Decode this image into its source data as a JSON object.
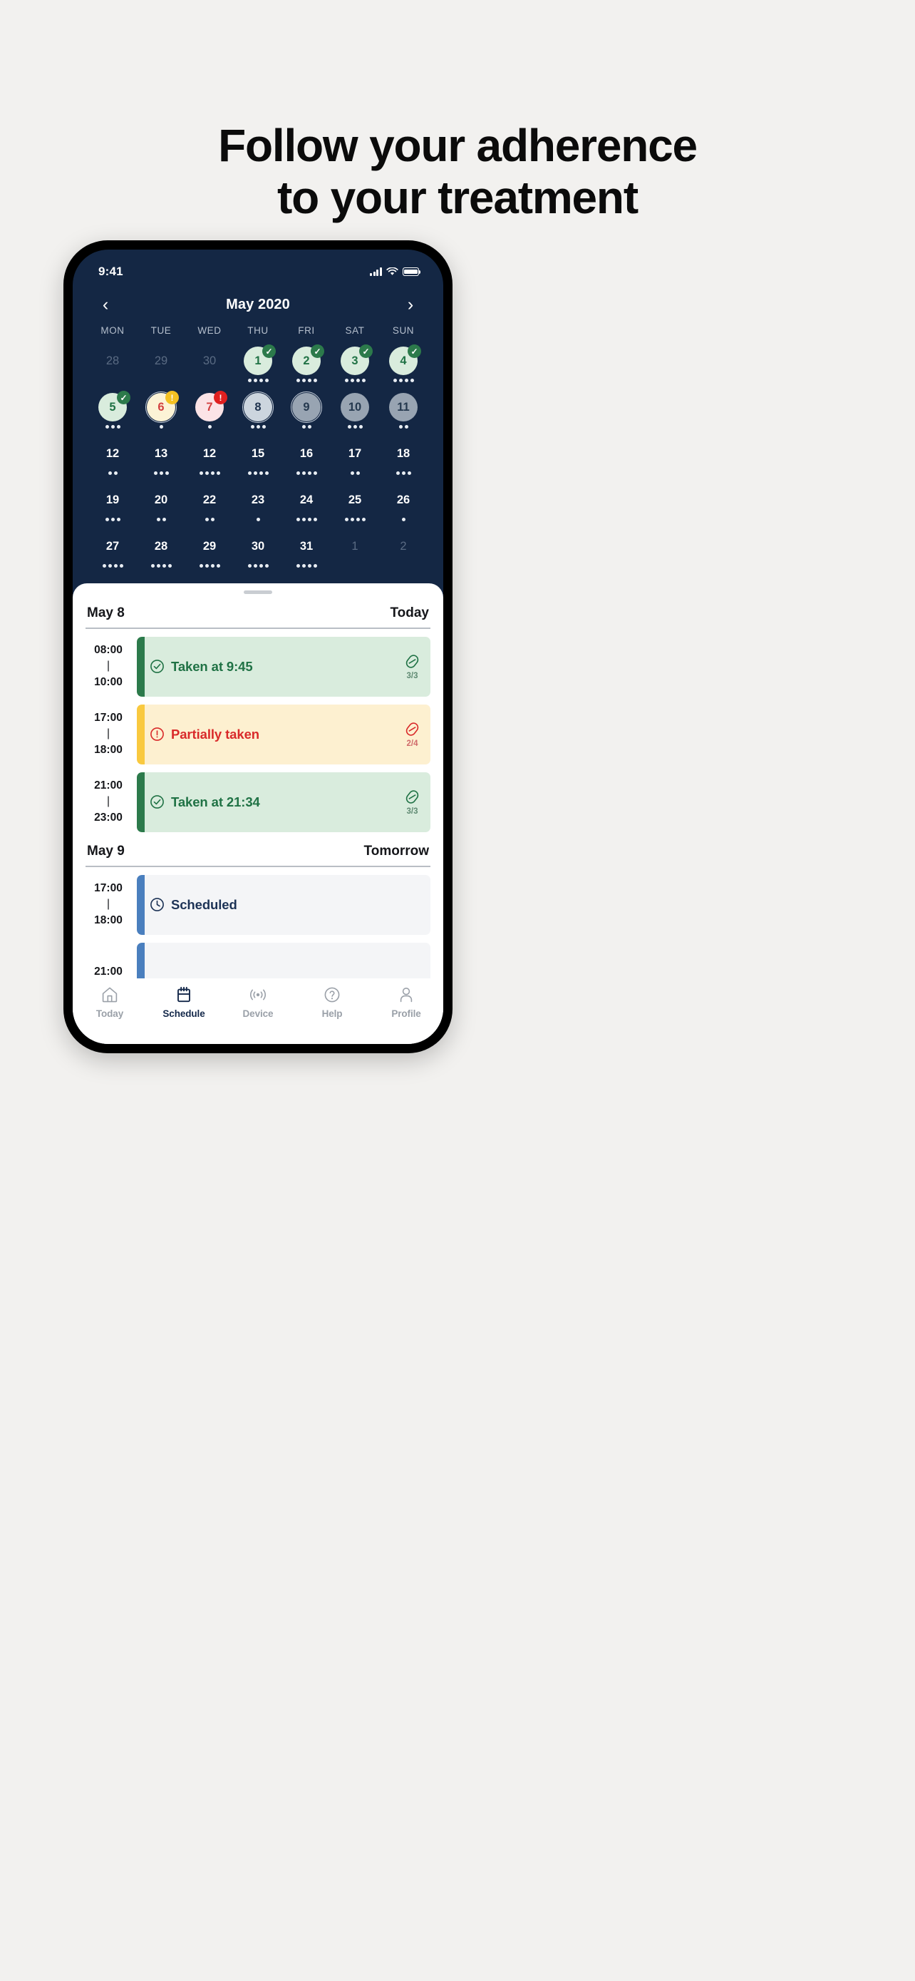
{
  "headline": {
    "line1": "Follow your adherence",
    "line2": "to your treatment"
  },
  "colors": {
    "page_bg": "#f2f1ef",
    "phone_screen_bg": "#142744",
    "accent_green": "#2c7a4b",
    "accent_yellow": "#f4c123",
    "accent_red": "#e02020",
    "accent_blue": "#4a7fbe",
    "nav_active": "#14284a"
  },
  "status_bar": {
    "time": "9:41",
    "icons": [
      "cellular-signal-icon",
      "wifi-icon",
      "battery-icon"
    ]
  },
  "calendar": {
    "prev_icon": "chevron-left-icon",
    "next_icon": "chevron-right-icon",
    "title": "May 2020",
    "weekdays": [
      "MON",
      "TUE",
      "WED",
      "THU",
      "FRI",
      "SAT",
      "SUN"
    ],
    "days": [
      {
        "label": "28",
        "state": "outside",
        "dots": 0,
        "badge": null
      },
      {
        "label": "29",
        "state": "outside",
        "dots": 0,
        "badge": null
      },
      {
        "label": "30",
        "state": "outside",
        "dots": 0,
        "badge": null
      },
      {
        "label": "1",
        "state": "taken",
        "dots": 4,
        "badge": "check"
      },
      {
        "label": "2",
        "state": "taken",
        "dots": 4,
        "badge": "check"
      },
      {
        "label": "3",
        "state": "taken",
        "dots": 4,
        "badge": "check"
      },
      {
        "label": "4",
        "state": "taken",
        "dots": 4,
        "badge": "check"
      },
      {
        "label": "5",
        "state": "taken",
        "dots": 3,
        "badge": "check"
      },
      {
        "label": "6",
        "state": "partial",
        "dots": 1,
        "badge": "warning",
        "ring": true
      },
      {
        "label": "7",
        "state": "missed",
        "dots": 1,
        "badge": "alert"
      },
      {
        "label": "8",
        "state": "today",
        "dots": 3,
        "badge": null,
        "ring": true
      },
      {
        "label": "9",
        "state": "upcoming",
        "dots": 2,
        "badge": null,
        "ring": true
      },
      {
        "label": "10",
        "state": "upcoming",
        "dots": 3,
        "badge": null
      },
      {
        "label": "11",
        "state": "upcoming",
        "dots": 2,
        "badge": null
      },
      {
        "label": "12",
        "state": "plain",
        "dots": 2,
        "badge": null
      },
      {
        "label": "13",
        "state": "plain",
        "dots": 3,
        "badge": null
      },
      {
        "label": "12",
        "state": "plain",
        "dots": 4,
        "badge": null
      },
      {
        "label": "15",
        "state": "plain",
        "dots": 4,
        "badge": null
      },
      {
        "label": "16",
        "state": "plain",
        "dots": 4,
        "badge": null
      },
      {
        "label": "17",
        "state": "plain",
        "dots": 2,
        "badge": null
      },
      {
        "label": "18",
        "state": "plain",
        "dots": 3,
        "badge": null
      },
      {
        "label": "19",
        "state": "plain",
        "dots": 3,
        "badge": null
      },
      {
        "label": "20",
        "state": "plain",
        "dots": 2,
        "badge": null
      },
      {
        "label": "22",
        "state": "plain",
        "dots": 2,
        "badge": null
      },
      {
        "label": "23",
        "state": "plain",
        "dots": 1,
        "badge": null
      },
      {
        "label": "24",
        "state": "plain",
        "dots": 4,
        "badge": null
      },
      {
        "label": "25",
        "state": "plain",
        "dots": 4,
        "badge": null
      },
      {
        "label": "26",
        "state": "plain",
        "dots": 1,
        "badge": null
      },
      {
        "label": "27",
        "state": "plain",
        "dots": 4,
        "badge": null
      },
      {
        "label": "28",
        "state": "plain",
        "dots": 4,
        "badge": null
      },
      {
        "label": "29",
        "state": "plain",
        "dots": 4,
        "badge": null
      },
      {
        "label": "30",
        "state": "plain",
        "dots": 4,
        "badge": null
      },
      {
        "label": "31",
        "state": "plain",
        "dots": 4,
        "badge": null
      },
      {
        "label": "1",
        "state": "outside",
        "dots": 0,
        "badge": null
      },
      {
        "label": "2",
        "state": "outside",
        "dots": 0,
        "badge": null
      }
    ]
  },
  "sheet": {
    "sections": [
      {
        "date": "May 8",
        "relative": "Today",
        "entries": [
          {
            "start": "08:00",
            "sep": "|",
            "end": "10:00",
            "status": "Taken at 9:45",
            "kind": "taken",
            "status_icon": "check-circle-icon",
            "pill_icon": "pill-icon",
            "fraction": "3/3"
          },
          {
            "start": "17:00",
            "sep": "|",
            "end": "18:00",
            "status": "Partially taken",
            "kind": "partial",
            "status_icon": "exclamation-circle-icon",
            "pill_icon": "pill-icon",
            "fraction": "2/4"
          },
          {
            "start": "21:00",
            "sep": "|",
            "end": "23:00",
            "status": "Taken at 21:34",
            "kind": "taken",
            "status_icon": "check-circle-icon",
            "pill_icon": "pill-icon",
            "fraction": "3/3"
          }
        ]
      },
      {
        "date": "May 9",
        "relative": "Tomorrow",
        "entries": [
          {
            "start": "17:00",
            "sep": "|",
            "end": "18:00",
            "status": "Scheduled",
            "kind": "scheduled",
            "status_icon": "clock-icon",
            "pill_icon": null,
            "fraction": ""
          },
          {
            "start": "21:00",
            "sep": "",
            "end": "",
            "status": "",
            "kind": "scheduled",
            "status_icon": null,
            "pill_icon": null,
            "fraction": ""
          }
        ]
      }
    ]
  },
  "tabbar": {
    "items": [
      {
        "label": "Today",
        "icon": "home-icon",
        "active": false
      },
      {
        "label": "Schedule",
        "icon": "calendar-icon",
        "active": true
      },
      {
        "label": "Device",
        "icon": "signal-icon",
        "active": false
      },
      {
        "label": "Help",
        "icon": "help-icon",
        "active": false
      },
      {
        "label": "Profile",
        "icon": "person-icon",
        "active": false
      }
    ]
  }
}
